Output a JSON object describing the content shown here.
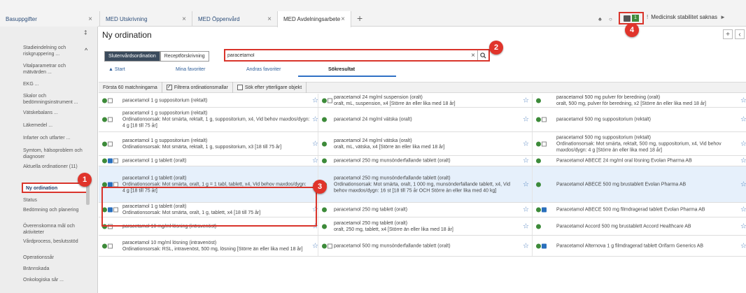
{
  "topbar": {
    "left_tab": "Basuppgifter",
    "tabs": [
      {
        "label": "MED Utskrivning"
      },
      {
        "label": "MED Öppenvård"
      },
      {
        "label": "MED Avdelningsarbete"
      }
    ],
    "icon_count": "1",
    "status_text": "Medicinsk stabilitet saknas"
  },
  "sidebar": {
    "items": [
      "Stadieindelning och riskgruppering ...",
      "Vitalparametrar och mätvärden ...",
      "EKG ...",
      "Skalor och bedömningsinstrument ...",
      "Vätskebalans ...",
      "Läkemedel ...",
      "Infarter och utfarter ...",
      "Symtom, hälsoproblem och diagnoser",
      "Aktuella ordinationer (11)",
      "Ny ordination",
      "Status",
      "Bedömning och planering",
      "Överenskomna mål och aktiviteter",
      "Vårdprocess, beslutsstöd",
      "Operationssår",
      "Brännskada",
      "Onkologiska sår ..."
    ]
  },
  "main": {
    "title": "Ny ordination",
    "type_buttons": [
      "Slutenvårdsordination",
      "Receptförskrivning"
    ],
    "search_value": "paracetamol",
    "subtabs": [
      "Start",
      "Mina favoriter",
      "Andras favoriter",
      "Sökresultat"
    ],
    "filter": {
      "first": "Första 60 matchningarna",
      "filter_label": "Filtrera ordinationsmallar",
      "more_label": "Sök efter ytterligare objekt"
    }
  },
  "results": [
    [
      "paracetamol 1 g suppositorium (rektalt)",
      "paracetamol 24 mg/ml suspension (oralt)\noralt, mL, suspension, x4 [Större än eller lika med 18 år]",
      "paracetamol 500 mg pulver för beredning (oralt)\noralt, 500 mg, pulver för beredning, x2 [Större än eller lika med 18 år]"
    ],
    [
      "paracetamol 1 g suppositorium (rektalt)\nOrdinationsorsak: Mot smärta, rektalt, 1 g, suppositorium, x4, Vid behov maxdos/dygn: 4 g [18 till 75 år]",
      "paracetamol 24 mg/ml vätska (oralt)",
      "paracetamol 500 mg suppositorium (rektalt)"
    ],
    [
      "paracetamol 1 g suppositorium (rektalt)\nOrdinationsorsak: Mot smärta, rektalt, 1 g, suppositorium, x3 [18 till 75 år]",
      "paracetamol 24 mg/ml vätska (oralt)\noralt, mL, vätska, x4 [Större än eller lika med 18 år]",
      "paracetamol 500 mg suppositorium (rektalt)\nOrdinationsorsak: Mot smärta, rektalt, 500 mg, suppositorium, x4, Vid behov maxdos/dygn: 4 g [Större än eller lika med 18 år]"
    ],
    [
      "paracetamol 1 g tablett (oralt)",
      "paracetamol 250 mg munsönderfallande tablett (oralt)",
      "Paracetamol ABECE 24 mg/ml oral lösning Evolan Pharma AB"
    ],
    [
      "paracetamol 1 g tablett (oralt)\nOrdinationsorsak: Mot smärta, oralt, 1 g = 1 tabl, tablett, x4, Vid behov maxdos/dygn: 4 g [18 till 75 år]",
      "paracetamol 250 mg munsönderfallande tablett (oralt)\nOrdinationsorsak: Mot smärta, oralt, 1 000 mg, munsönderfallande tablett, x4, Vid behov maxdos/dygn: 16 st [18 till 75 år OCH Större än eller lika med 40 kg]",
      "Paracetamol ABECE 500 mg brustablett Evolan Pharma AB"
    ],
    [
      "paracetamol 1 g tablett (oralt)\nOrdinationsorsak: Mot smärta, oralt, 1 g, tablett, x4 [18 till 75 år]",
      "paracetamol 250 mg tablett (oralt)",
      "Paracetamol ABECE 500 mg filmdragerad tablett Evolan Pharma AB"
    ],
    [
      "paracetamol 10 mg/ml lösning (intravenöst)",
      "paracetamol 250 mg tablett (oralt)\noralt, 250 mg, tablett, x4 [Större än eller lika med 18 år]",
      "Paracetamol Accord 500 mg brustablett Accord Healthcare AB"
    ],
    [
      "paracetamol 10 mg/ml lösning (intravenöst)\nOrdinationsorsak: RSL, intravenöst, 500 mg, lösning [Större än eller lika med 18 år]",
      "paracetamol 500 mg munsönderfallande tablett (oralt)",
      "Paracetamol Alternova 1 g filmdragerad tablett Orifarm Generics AB"
    ]
  ],
  "callouts": [
    "1",
    "2",
    "3",
    "4"
  ],
  "colors": {
    "accent_red": "#d9342b",
    "link_blue": "#2c5d99",
    "green_status": "#3c8a39"
  }
}
